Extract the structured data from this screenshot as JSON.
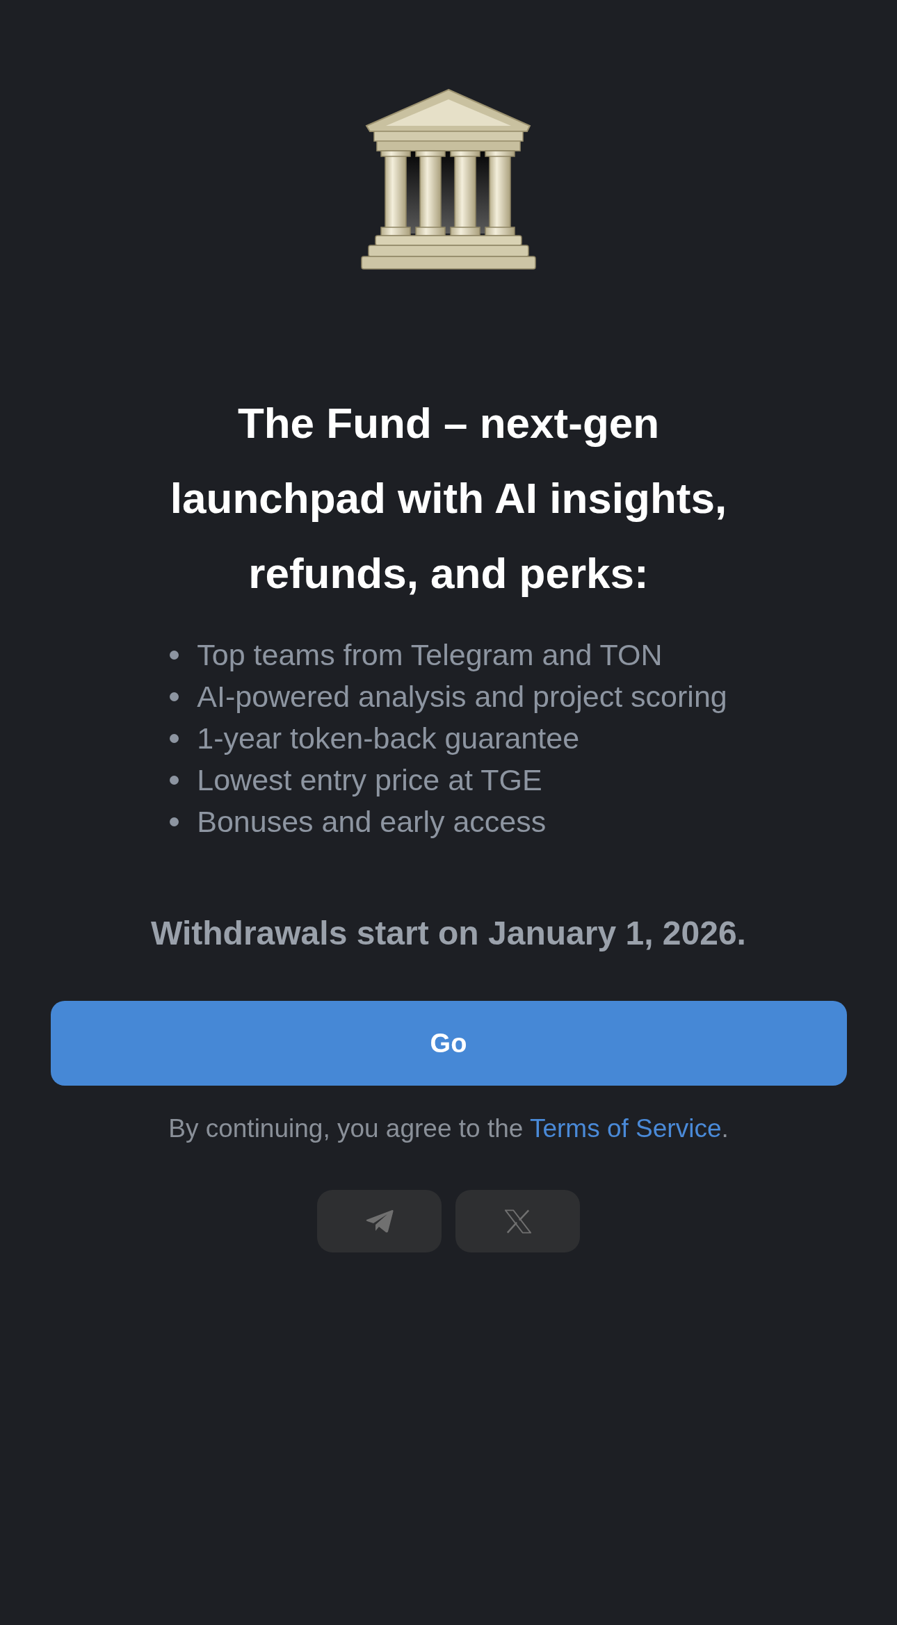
{
  "title": "The Fund – next-gen launchpad with AI insights, refunds, and perks:",
  "features": [
    "Top teams from Telegram and TON",
    "AI-powered analysis and project scoring",
    "1-year token-back guarantee",
    "Lowest entry price at TGE",
    "Bonuses and early access"
  ],
  "notice": "Withdrawals start on January 1, 2026.",
  "primary_button": {
    "label": "Go"
  },
  "terms": {
    "text": "By continuing, you agree to the ",
    "link": "Terms of Service",
    "end": "."
  },
  "social_links": [
    {
      "kind": "telegram"
    },
    {
      "kind": "x"
    }
  ]
}
